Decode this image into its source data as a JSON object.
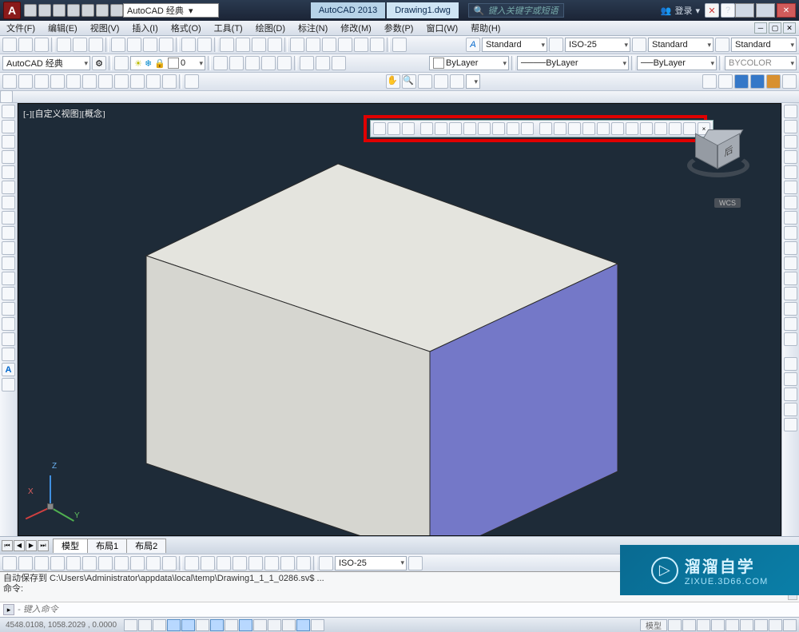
{
  "title": {
    "app": "AutoCAD 2013",
    "doc": "Drawing1.dwg",
    "search_ph": "键入关键字或短语",
    "signin": "登录"
  },
  "workspace": {
    "name": "AutoCAD 经典",
    "name2": "AutoCAD 经典"
  },
  "menu": [
    "文件(F)",
    "编辑(E)",
    "视图(V)",
    "插入(I)",
    "格式(O)",
    "工具(T)",
    "绘图(D)",
    "标注(N)",
    "修改(M)",
    "参数(P)",
    "窗口(W)",
    "帮助(H)"
  ],
  "styles": {
    "text": "Standard",
    "dim": "ISO-25",
    "table": "Standard",
    "mleader": "Standard"
  },
  "layer": {
    "name": "0",
    "by": "ByLayer",
    "lt": "ByLayer",
    "lw": "ByLayer",
    "col": "BYCOLOR"
  },
  "viewlabel": "[-][自定义视图][概念]",
  "viewcube": {
    "face": "后",
    "wcs": "WCS"
  },
  "tabs": [
    "模型",
    "布局1",
    "布局2"
  ],
  "dimtb_style": "ISO-25",
  "cmd": {
    "line1": "自动保存到 C:\\Users\\Administrator\\appdata\\local\\temp\\Drawing1_1_1_0286.sv$ ...",
    "line2": "命令:",
    "prompt_ph": "- 键入命令"
  },
  "status": {
    "coords": "4548.0108, 1058.2029 , 0.0000",
    "tab": "模型"
  },
  "watermark": {
    "t1": "溜溜自学",
    "t2": "ZIXUE.3D66.COM"
  },
  "ucs": {
    "x": "X",
    "y": "Y",
    "z": "Z"
  }
}
